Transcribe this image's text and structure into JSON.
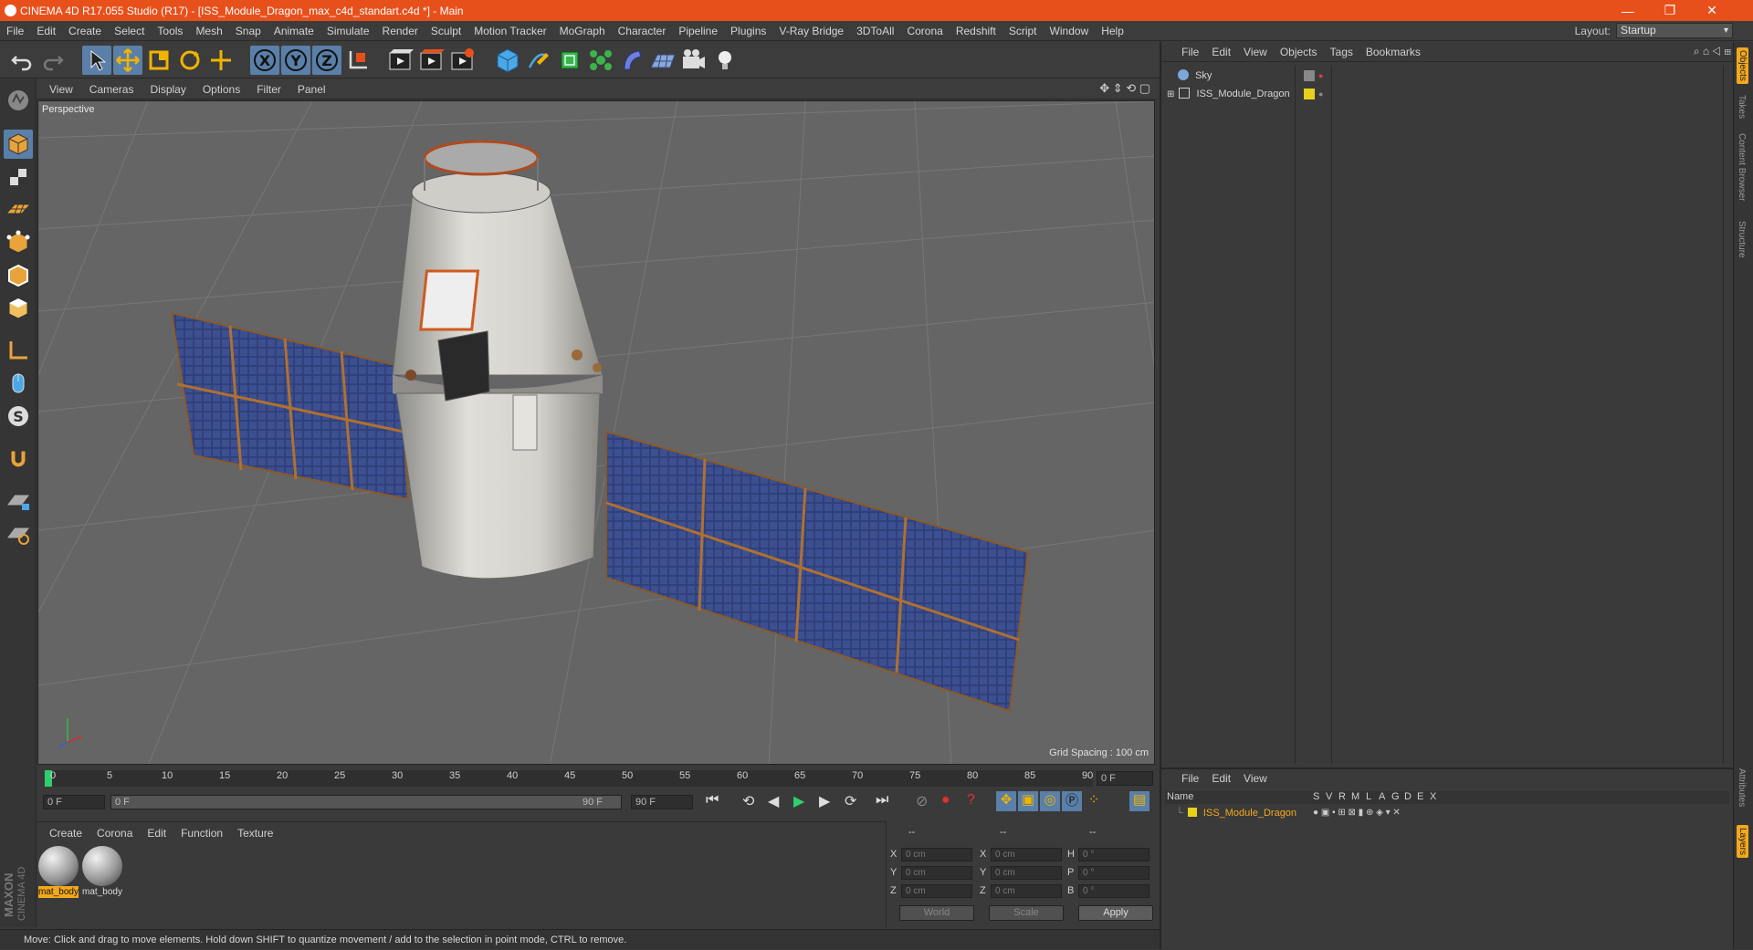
{
  "window": {
    "title": "CINEMA 4D R17.055 Studio (R17) - [ISS_Module_Dragon_max_c4d_standart.c4d *] - Main",
    "minimize": "—",
    "restore": "❐",
    "close": "✕"
  },
  "menu": [
    "File",
    "Edit",
    "Create",
    "Select",
    "Tools",
    "Mesh",
    "Snap",
    "Animate",
    "Simulate",
    "Render",
    "Sculpt",
    "Motion Tracker",
    "MoGraph",
    "Character",
    "Pipeline",
    "Plugins",
    "V-Ray Bridge",
    "3DToAll",
    "Corona",
    "Redshift",
    "Script",
    "Window",
    "Help"
  ],
  "layout": {
    "label": "Layout:",
    "value": "Startup"
  },
  "viewport": {
    "menu": [
      "View",
      "Cameras",
      "Display",
      "Options",
      "Filter",
      "Panel"
    ],
    "camera": "Perspective",
    "grid_spacing": "Grid Spacing : 100 cm"
  },
  "timeline": {
    "ticks": [
      "0",
      "5",
      "10",
      "15",
      "20",
      "25",
      "30",
      "35",
      "40",
      "45",
      "50",
      "55",
      "60",
      "65",
      "70",
      "75",
      "80",
      "85",
      "90"
    ],
    "current": "0 F",
    "start": "0 F",
    "range_start": "0 F",
    "range_end": "90 F",
    "end": "90 F"
  },
  "materials": {
    "menu": [
      "Create",
      "Corona",
      "Edit",
      "Function",
      "Texture"
    ],
    "items": [
      {
        "name": "mat_body"
      },
      {
        "name": "mat_body"
      }
    ]
  },
  "coords": {
    "headers": [
      "--",
      "--",
      "--"
    ],
    "rows": [
      {
        "l1": "X",
        "v1": "0 cm",
        "l2": "X",
        "v2": "0 cm",
        "l3": "H",
        "v3": "0 °"
      },
      {
        "l1": "Y",
        "v1": "0 cm",
        "l2": "Y",
        "v2": "0 cm",
        "l3": "P",
        "v3": "0 °"
      },
      {
        "l1": "Z",
        "v1": "0 cm",
        "l2": "Z",
        "v2": "0 cm",
        "l3": "B",
        "v3": "0 °"
      }
    ],
    "space": "World",
    "mode": "Scale",
    "apply": "Apply"
  },
  "status": "Move: Click and drag to move elements. Hold down SHIFT to quantize movement / add to the selection in point mode, CTRL to remove.",
  "objects": {
    "menu": [
      "File",
      "Edit",
      "View",
      "Objects",
      "Tags",
      "Bookmarks"
    ],
    "items": [
      {
        "name": "Sky",
        "icon": "sky-icon"
      },
      {
        "name": "ISS_Module_Dragon",
        "icon": "null-object-icon",
        "tag_color": "#e6d21a"
      }
    ]
  },
  "layers": {
    "menu": [
      "File",
      "Edit",
      "View"
    ],
    "columns": [
      "Name",
      "S",
      "V",
      "R",
      "M",
      "L",
      "A",
      "G",
      "D",
      "E",
      "X"
    ],
    "items": [
      {
        "name": "ISS_Module_Dragon",
        "color": "#e6d21a"
      }
    ]
  },
  "right_tabs": [
    "Objects",
    "Takes",
    "Content Browser",
    "Structure",
    "Attributes",
    "Layers"
  ],
  "brand": {
    "line1": "MAXON",
    "line2": "CINEMA 4D"
  },
  "colors": {
    "accent": "#e8501b",
    "selected": "#5a7fa8",
    "highlight": "#f2a81d"
  }
}
